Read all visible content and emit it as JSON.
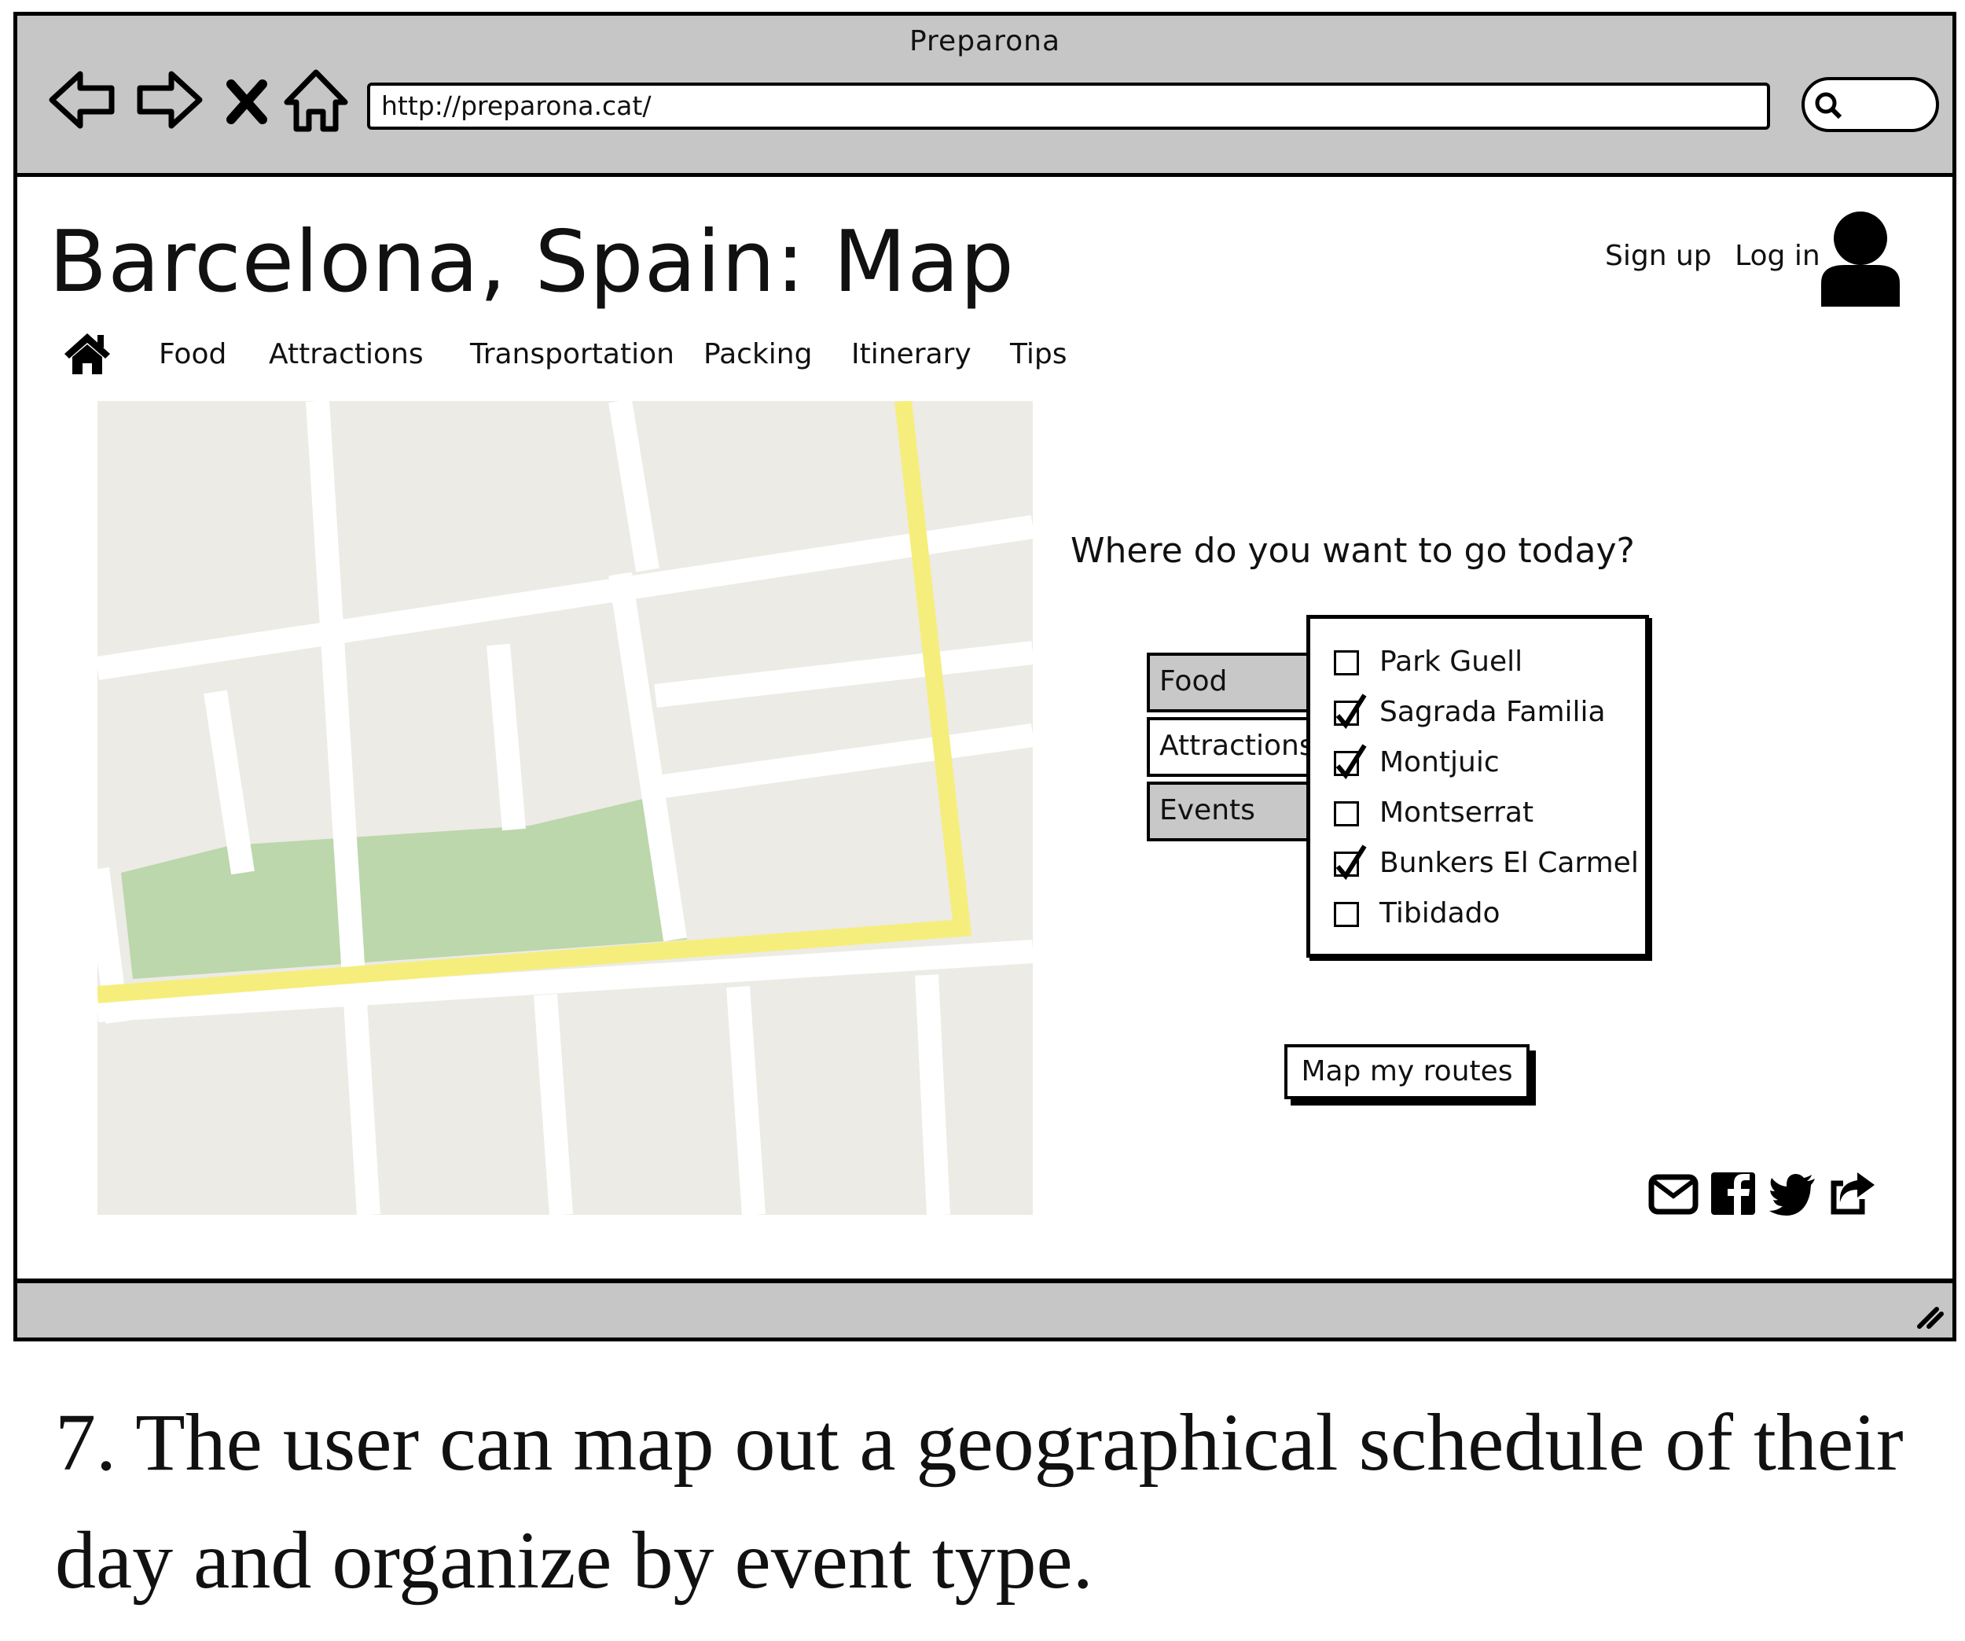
{
  "browser": {
    "window_title": "Preparona",
    "url": "http://preparona.cat/"
  },
  "page": {
    "title": "Barcelona, Spain: Map",
    "auth": {
      "sign_up": "Sign up",
      "log_in": "Log in"
    },
    "nav": [
      "Food",
      "Attractions",
      "Transportation",
      "Packing",
      "Itinerary",
      "Tips"
    ],
    "question": "Where do you want to go today?",
    "tabs": [
      {
        "label": "Food",
        "active": false
      },
      {
        "label": "Attractions",
        "active": true
      },
      {
        "label": "Events",
        "active": false
      }
    ],
    "checklist": [
      {
        "label": "Park Guell",
        "checked": false
      },
      {
        "label": "Sagrada Familia",
        "checked": true
      },
      {
        "label": "Montjuic",
        "checked": true
      },
      {
        "label": "Montserrat",
        "checked": false
      },
      {
        "label": "Bunkers El Carmel",
        "checked": true
      },
      {
        "label": "Tibidado",
        "checked": false
      }
    ],
    "button": "Map my routes",
    "share_icons": [
      "email-icon",
      "facebook-icon",
      "twitter-icon",
      "share-icon"
    ]
  },
  "map_colors": {
    "background": "#ecebe6",
    "road": "#ffffff",
    "route": "#f6ee7c",
    "park": "#bcd7ab"
  },
  "caption": "7. The user can map out a geographical schedule of their day and organize by event type."
}
